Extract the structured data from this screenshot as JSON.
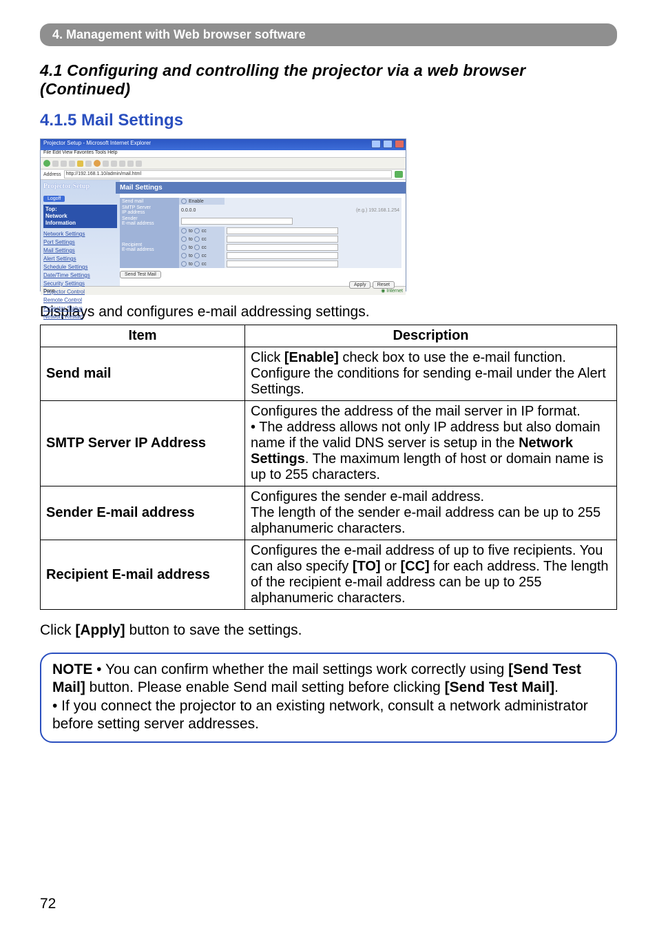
{
  "topBar": {
    "text": "4. Management with Web browser software"
  },
  "heading": "4.1 Configuring and controlling the projector via a web browser (Continued)",
  "sectionTitle": "4.1.5 Mail Settings",
  "miniWindow": {
    "title": "Projector Setup - Microsoft Internet Explorer",
    "menuItems": "File   Edit   View   Favorites   Tools   Help",
    "addressLabel": "Address",
    "addressValue": "http://192.168.1.10/admin/mail.html",
    "sidebar": {
      "headline": "Projector Setup",
      "logoff": "Logoff",
      "topNetwork": "Top:\nNetwork\nInformation",
      "links": [
        "Network Settings",
        "Port Settings",
        "Mail Settings",
        "Alert Settings",
        "Schedule Settings",
        "Date/Time Settings",
        "Security Settings",
        "Projector Control",
        "Remote Control",
        "Projector Status",
        "Network Restart"
      ]
    },
    "main": {
      "title": "Mail Settings",
      "rows": {
        "sendMailLabel": "Send mail",
        "enableLabel": "Enable",
        "smtpLabel": "SMTP Server\nIP address",
        "zeroIP": "0.0.0.0",
        "exampleIP": "(e.g.) 192.168.1.254",
        "senderLabel": "Sender\nE-mail address",
        "recipientLabel": "Recipient\nE-mail address",
        "toLabel": "to",
        "ccLabel": "cc",
        "sendTestBtn": "Send Test Mail",
        "applyBtn": "Apply",
        "resetBtn": "Reset"
      }
    },
    "status": {
      "done": "Done",
      "internet": "Internet"
    }
  },
  "subText": "Displays and configures e-mail addressing settings.",
  "tableHeaders": {
    "item": "Item",
    "desc": "Description"
  },
  "rows": [
    {
      "item": "Send mail",
      "desc_pre": "Click ",
      "desc_b1": "[Enable]",
      "desc_mid": " check box to use the e-mail function. Configure the conditions for sending e-mail under the Alert Settings."
    },
    {
      "item": "SMTP Server IP Address",
      "desc_pre": "Configures the address of the mail server in IP format.\n• The address allows not only IP address but also domain name if the valid DNS server is setup in the ",
      "desc_b1": "Network Settings",
      "desc_mid": ". The maximum length of host or domain name is up to 255 characters."
    },
    {
      "item": "Sender E-mail address",
      "desc_pre": "Configures the sender e-mail address.\nThe length of the sender e-mail address can be up to 255 alphanumeric characters."
    },
    {
      "item": "Recipient E-mail address",
      "desc_pre": "Configures the e-mail address of up to five recipients. You can also specify ",
      "desc_b1": "[TO]",
      "desc_mid": " or ",
      "desc_b2": "[CC]",
      "desc_post": " for each address. The length of the recipient e-mail address can be up to 255 alphanumeric characters."
    }
  ],
  "applyLine": {
    "pre": "Click ",
    "b": "[Apply]",
    "post": " button to save the settings."
  },
  "note": {
    "label": "NOTE",
    "t1": "  • You can confirm whether the mail settings work correctly using ",
    "b1": "[Send Test Mail]",
    "t2": " button. Please enable Send mail setting before clicking ",
    "b2": "[Send Test Mail]",
    "t3": ".",
    "t4": "• If you connect the projector to an existing network, consult a network administrator before setting server addresses."
  },
  "pageNumber": "72"
}
